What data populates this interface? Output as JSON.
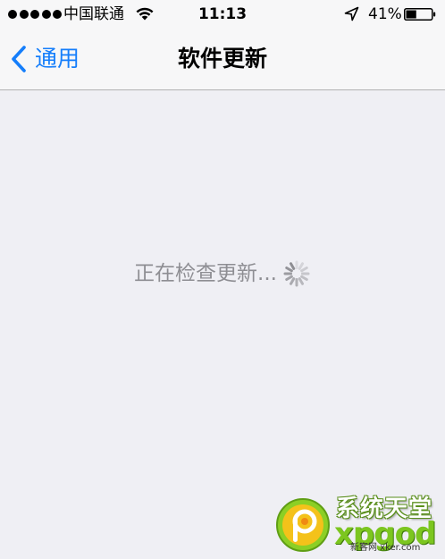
{
  "status_bar": {
    "carrier": "中国联通",
    "time": "11:13",
    "battery_percent": "41%",
    "battery_level": 0.41,
    "signal_bars": 5,
    "icons": [
      "signal-dots-icon",
      "wifi-icon",
      "location-arrow-icon",
      "battery-icon"
    ]
  },
  "nav": {
    "back_label": "通用",
    "title": "软件更新"
  },
  "content": {
    "status_text": "正在检查更新..."
  },
  "watermark": {
    "brand": "系统天堂",
    "word": "xpgod",
    "url": "新客网 xker.com"
  },
  "colors": {
    "accent": "#157efb",
    "background": "#efeff4",
    "bar_background": "#f7f7f8",
    "muted_text": "#8e8e93",
    "watermark_green": "#7cc61f"
  }
}
